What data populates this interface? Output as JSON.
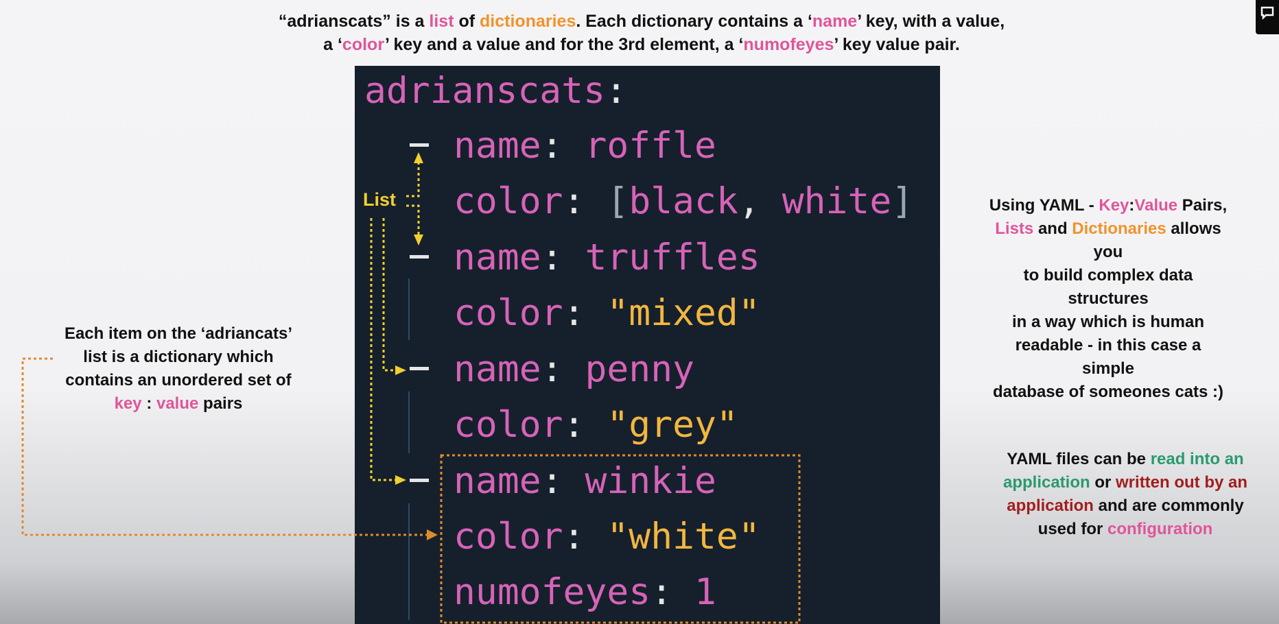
{
  "top_caption": {
    "t1": "“adrianscats” is a ",
    "t2": "list",
    "t3": " of ",
    "t4": "dictionaries",
    "t5": ". Each dictionary contains a ‘",
    "t6": "name",
    "t7": "’ key, with a value,",
    "t8": "a ‘",
    "t9": "color",
    "t10": "’ key and a value and for the 3rd element, a ‘",
    "t11": "numofeyes",
    "t12": "’ key value pair."
  },
  "yaml": {
    "root": "adrianscats",
    "colon": ":",
    "comma": ",",
    "open_bracket": "[",
    "close_bracket": "]",
    "name_key": "name",
    "color_key": "color",
    "eyes_key": "numofeyes",
    "items": [
      {
        "name": "roffle",
        "color_a": "black",
        "color_b": "white"
      },
      {
        "name": "truffles",
        "color": "\"mixed\""
      },
      {
        "name": "penny",
        "color": "\"grey\""
      },
      {
        "name": "winkie",
        "color": "\"white\"",
        "numofeyes": "1"
      }
    ]
  },
  "list_label": "List",
  "left_note": {
    "line1": "Each item on the ‘adriancats’",
    "line2": "list is a dictionary which",
    "line3": "contains an unordered set of",
    "key": "key",
    "sep": " : ",
    "value": "value",
    "tail": " pairs"
  },
  "right_note_1": {
    "a1": "Using YAML - ",
    "a2": "Key",
    "a3": ":",
    "a4": "Value",
    "a5": " Pairs,",
    "b1": "Lists",
    "b2": " and ",
    "b3": "Dictionaries",
    "b4": " allows you",
    "c": "to build complex data structures",
    "d": "in a way which is human",
    "e": "readable - in this case a simple",
    "f": "database of someones cats :)"
  },
  "right_note_2": {
    "a1": "YAML files can be ",
    "a2": "read into an",
    "b1": "application",
    "b2": " or ",
    "b3": "written out by an",
    "c1": "application",
    "c2": " and are commonly",
    "d1": "used for ",
    "d2": "configuration"
  },
  "colors": {
    "panel_bg": "#15202c",
    "yaml_key": "#d763b8",
    "yaml_string": "#f3b63f",
    "highlight_pink": "#e0559a",
    "highlight_orange": "#f0932b",
    "arrow_yellow": "#f2cf2e",
    "arrow_orange": "#e08a2a",
    "read_green": "#2a9a6e",
    "write_red": "#a31d1d"
  }
}
